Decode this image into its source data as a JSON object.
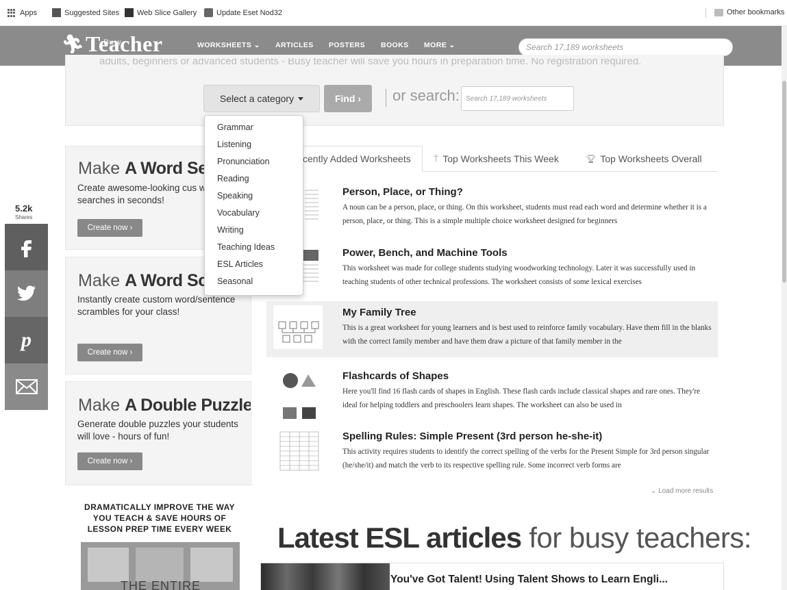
{
  "bookmarks": {
    "apps": "Apps",
    "suggested": "Suggested Sites",
    "webslice": "Web Slice Gallery",
    "eset": "Update Eset Nod32",
    "other": "Other bookmarks"
  },
  "header": {
    "logo_busy": "Busy",
    "logo_main": "Teacher",
    "nav": [
      "WORKSHEETS ⌄",
      "ARTICLES",
      "POSTERS",
      "BOOKS",
      "MORE ⌄"
    ],
    "search_placeholder": "Search 17,189 worksheets"
  },
  "hero": {
    "cut_text": "adults, beginners or advanced students - Busy teacher will save you hours in preparation time. No registration required.",
    "select_label": "Select a category",
    "find_label": "Find ›",
    "or_search": "or search:",
    "search_placeholder": "Search 17,189 worksheets"
  },
  "dropdown": [
    "Grammar",
    "Listening",
    "Pronunciation",
    "Reading",
    "Speaking",
    "Vocabulary",
    "Writing",
    "Teaching Ideas",
    "ESL Articles",
    "Seasonal"
  ],
  "promos": [
    {
      "title_light": "Make ",
      "title_bold": "A Word Sea",
      "desc": "Create awesome-looking cus word searches in seconds!",
      "button": "Create now ›"
    },
    {
      "title_light": "Make ",
      "title_bold": "A Word Scram",
      "desc": "Instantly create custom word/sentence scrambles for your class!",
      "button": "Create now ›"
    },
    {
      "title_light": "Make ",
      "title_bold": "A Double Puzzle:",
      "desc": "Generate double puzzles your students will love - hours of fun!",
      "button": "Create now ›"
    }
  ],
  "dramatic": "DRAMATICALLY IMPROVE THE WAY YOU TEACH & SAVE HOURS OF LESSON PREP TIME EVERY WEEK",
  "book_title": "THE ENTIRE",
  "share": {
    "count": "5.2k",
    "label": "Shares"
  },
  "tabs": {
    "recent": "cently Added Worksheets",
    "week": "Top Worksheets This Week",
    "overall": "Top Worksheets Overall"
  },
  "worksheets": [
    {
      "title": "Person, Place, or Thing?",
      "desc": "A noun can be a person, place, or thing. On this worksheet, students must read each word and determine whether it is a person, place, or thing. This is a simple multiple choice worksheet designed for beginners"
    },
    {
      "title": "Power, Bench, and Machine Tools",
      "desc": "This worksheet was made for college students studying woodworking technology. Later it was successfully used in teaching students of other technical professions. The worksheet consists of some lexical exercises"
    },
    {
      "title": "My Family Tree",
      "desc": "This is a great worksheet for young learners and is best used to reinforce family vocabulary. Have them fill in the blanks with the correct family member and have them draw a picture of that family member in the"
    },
    {
      "title": "Flashcards of Shapes",
      "desc": "Here you'll find 16 flash cards of shapes in English. These flash cards include classical shapes and rare ones. They're ideal for helping toddlers and preschoolers learn shapes. The worksheet can also be used in"
    },
    {
      "title": "Spelling Rules: Simple Present (3rd person he-she-it)",
      "desc": "This activity requires students to identify the correct spelling of the verbs for the Present Simple for 3rd person singular (he/she/it) and match the verb to its respective spelling rule. Some incorrect verb forms are"
    }
  ],
  "load_more": "⌄ Load more results",
  "latest": {
    "bold": "Latest ESL articles",
    "light": " for busy teachers:"
  },
  "article": {
    "title": "You've Got Talent! Using Talent Shows to Learn Engli..."
  }
}
